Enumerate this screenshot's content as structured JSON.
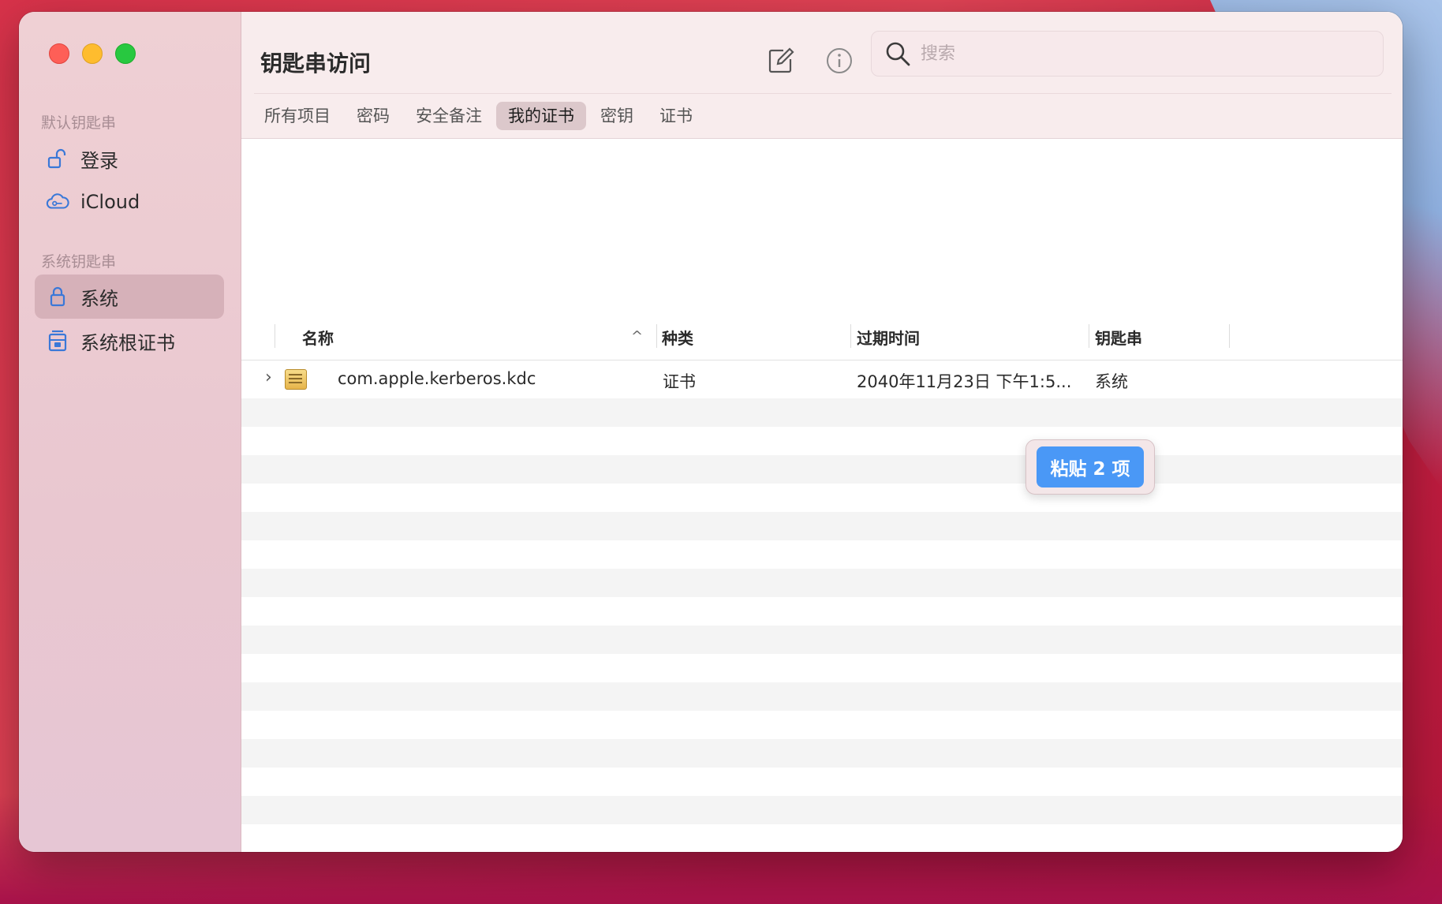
{
  "app": {
    "title": "钥匙串访问"
  },
  "sidebar": {
    "section_default": "默认钥匙串",
    "section_system": "系统钥匙串",
    "items": [
      {
        "label": "登录",
        "icon": "unlocked-lock-icon"
      },
      {
        "label": "iCloud",
        "icon": "icloud-icon"
      },
      {
        "label": "系统",
        "icon": "lock-icon",
        "selected": true
      },
      {
        "label": "系统根证书",
        "icon": "cabinet-icon"
      }
    ]
  },
  "toolbar": {
    "new_item_icon": "compose-icon",
    "info_icon": "info-icon",
    "search_placeholder": "搜索"
  },
  "tabs": [
    "所有项目",
    "密码",
    "安全备注",
    "我的证书",
    "密钥",
    "证书"
  ],
  "active_tab": "我的证书",
  "table": {
    "columns": [
      "名称",
      "种类",
      "过期时间",
      "钥匙串"
    ],
    "sort_indicator": "^",
    "rows": [
      {
        "name": "com.apple.kerberos.kdc",
        "kind": "证书",
        "expires": "2040年11月23日 下午1:5...",
        "keychain": "系统"
      }
    ]
  },
  "drag_badge": {
    "label": "粘贴 2 项"
  },
  "colors": {
    "accent": "#4a98f6",
    "close": "#fe5f57",
    "minimize": "#febc2e",
    "maximize": "#28c840"
  }
}
